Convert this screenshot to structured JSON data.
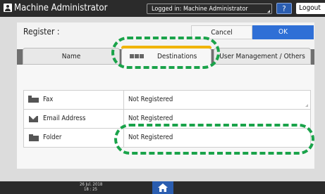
{
  "header": {
    "title": "Machine Administrator",
    "login_status": "Logged in: Machine Administrator",
    "help_label": "?",
    "logout_label": "Logout"
  },
  "register": {
    "title": "Register :",
    "cancel_label": "Cancel",
    "ok_label": "OK"
  },
  "tabs": [
    {
      "label": "Name"
    },
    {
      "label": "Destinations",
      "active": true
    },
    {
      "label": "User Management / Others"
    }
  ],
  "rows": [
    {
      "icon": "fax-icon",
      "label": "Fax",
      "value": "Not Registered"
    },
    {
      "icon": "mail-icon",
      "label": "Email Address",
      "value": "Not Registered"
    },
    {
      "icon": "folder-icon",
      "label": "Folder",
      "value": "Not Registered"
    }
  ],
  "footer": {
    "date": "26 Jul. 2018",
    "time": "18 : 25"
  },
  "colors": {
    "active_tab_accent": "#f0b400",
    "ok_button": "#2f6fd6",
    "highlight": "#1aa34a"
  }
}
